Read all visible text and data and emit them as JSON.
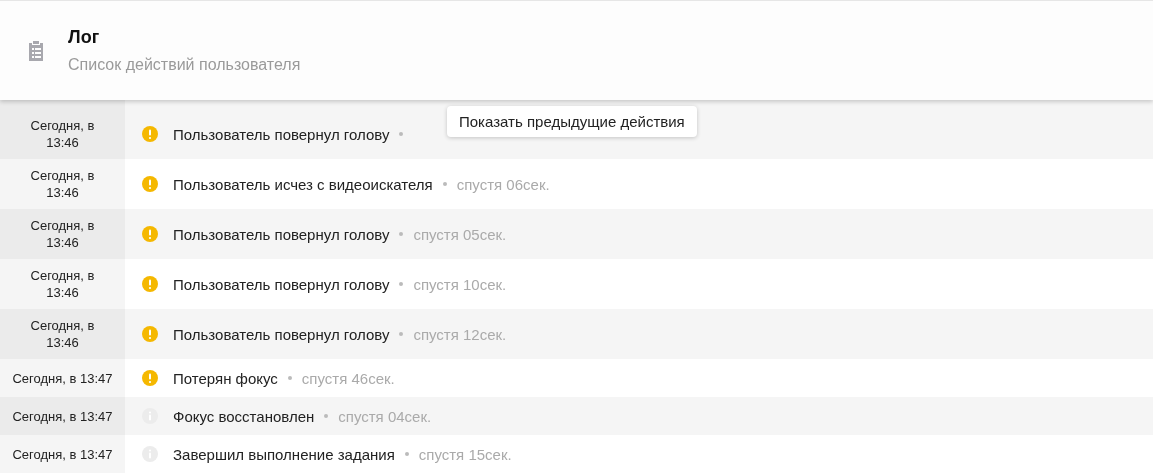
{
  "header": {
    "title": "Лог",
    "subtitle": "Список действий пользователя"
  },
  "tooltip": "Показать предыдущие действия",
  "rows": [
    {
      "time": "Сегодня, в 13:46",
      "kind": "warning",
      "message": "Пользователь повернул голову"
    },
    {
      "time": "Сегодня, в 13:46",
      "kind": "warning",
      "message": "Пользователь исчез с видеоискателя",
      "elapsed": "спустя 06сек."
    },
    {
      "time": "Сегодня, в 13:46",
      "kind": "warning",
      "message": "Пользователь повернул голову",
      "elapsed": "спустя 05сек."
    },
    {
      "time": "Сегодня, в 13:46",
      "kind": "warning",
      "message": "Пользователь повернул голову",
      "elapsed": "спустя 10сек."
    },
    {
      "time": "Сегодня, в 13:46",
      "kind": "warning",
      "message": "Пользователь повернул голову",
      "elapsed": "спустя 12сек."
    },
    {
      "time": "Сегодня, в 13:47",
      "kind": "warning",
      "message": "Потерян фокус",
      "elapsed": "спустя 46сек."
    },
    {
      "time": "Сегодня, в 13:47",
      "kind": "info",
      "message": "Фокус восстановлен",
      "elapsed": "спустя 04сек."
    },
    {
      "time": "Сегодня, в 13:47",
      "kind": "info",
      "message": "Завершил выполнение задания",
      "elapsed": "спустя 15сек."
    }
  ]
}
